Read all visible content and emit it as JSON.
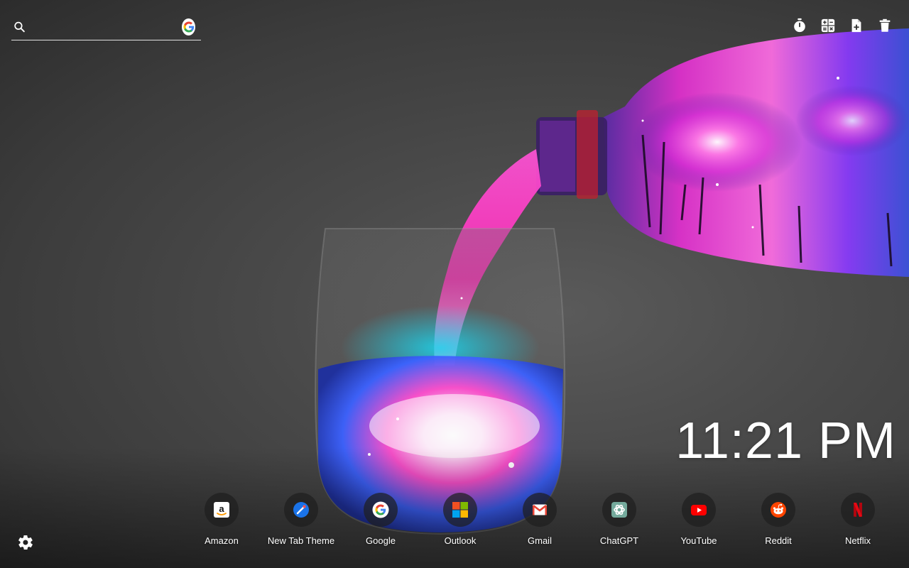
{
  "search": {
    "placeholder": "",
    "value": "",
    "engine_icon": "google-icon"
  },
  "tools": [
    {
      "name": "timer-icon"
    },
    {
      "name": "calculator-icon"
    },
    {
      "name": "add-note-icon"
    },
    {
      "name": "trash-icon"
    }
  ],
  "clock": {
    "time": "11:21 PM"
  },
  "shortcuts": [
    {
      "label": "Amazon",
      "icon": "amazon-icon"
    },
    {
      "label": "New Tab Theme",
      "icon": "new-tab-theme-icon"
    },
    {
      "label": "Google",
      "icon": "google-icon"
    },
    {
      "label": "Outlook",
      "icon": "outlook-icon"
    },
    {
      "label": "Gmail",
      "icon": "gmail-icon"
    },
    {
      "label": "ChatGPT",
      "icon": "chatgpt-icon"
    },
    {
      "label": "YouTube",
      "icon": "youtube-icon"
    },
    {
      "label": "Reddit",
      "icon": "reddit-icon"
    },
    {
      "label": "Netflix",
      "icon": "netflix-icon"
    }
  ],
  "settings": {
    "icon": "gear-icon"
  },
  "colors": {
    "background": "#4a4a4a",
    "galaxy_pink": "#ff3fcf",
    "galaxy_cyan": "#19d7f0",
    "galaxy_blue": "#2a4dff"
  }
}
